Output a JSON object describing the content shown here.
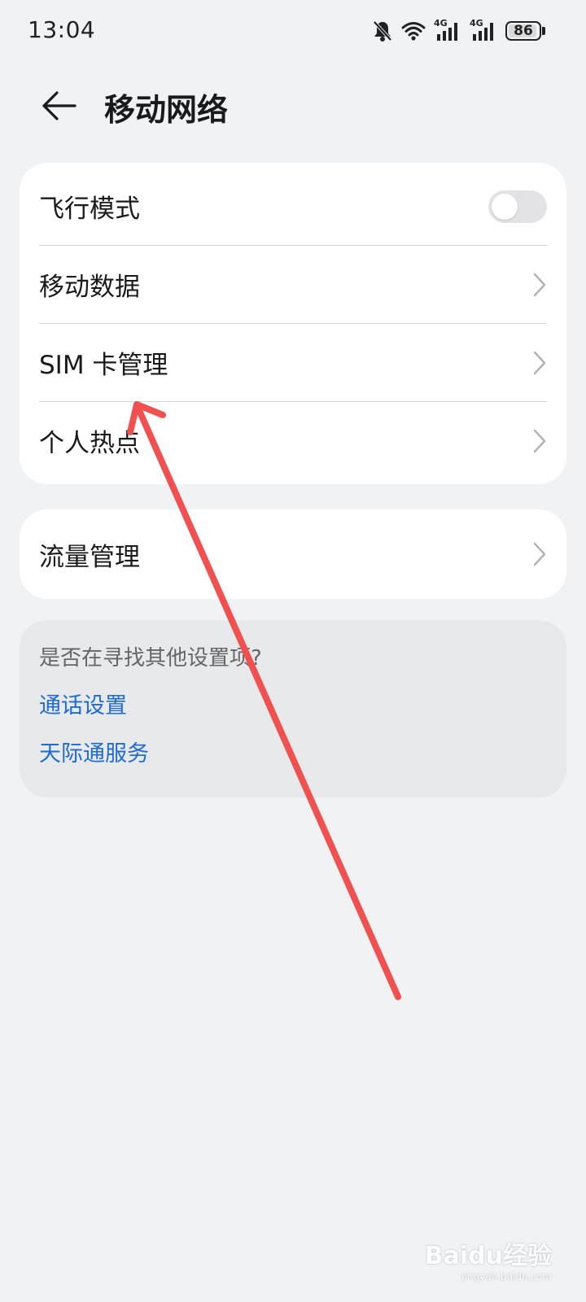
{
  "status_bar": {
    "time": "13:04",
    "network_1": "4G",
    "network_2": "4G",
    "battery": "86",
    "icons": [
      "bell-off-icon",
      "wifi-icon",
      "signal-4g-icon",
      "signal-4g-icon",
      "battery-icon"
    ]
  },
  "header": {
    "title": "移动网络",
    "back_icon": "arrow-left-icon"
  },
  "main_card": {
    "rows": [
      {
        "label": "飞行模式",
        "control": "toggle",
        "toggle_on": false
      },
      {
        "label": "移动数据",
        "control": "chevron"
      },
      {
        "label": "SIM 卡管理",
        "control": "chevron"
      },
      {
        "label": "个人热点",
        "control": "chevron"
      }
    ]
  },
  "traffic_card": {
    "label": "流量管理"
  },
  "suggestions": {
    "title": "是否在寻找其他设置项?",
    "links": [
      "通话设置",
      "天际通服务"
    ]
  },
  "watermark": {
    "logo": "Baidu经验",
    "sub": "jingyan.baidu.com"
  },
  "colors": {
    "background": "#f1f2f4",
    "card": "#ffffff",
    "link": "#1f6ad9",
    "annotation_arrow": "#f0504f"
  }
}
